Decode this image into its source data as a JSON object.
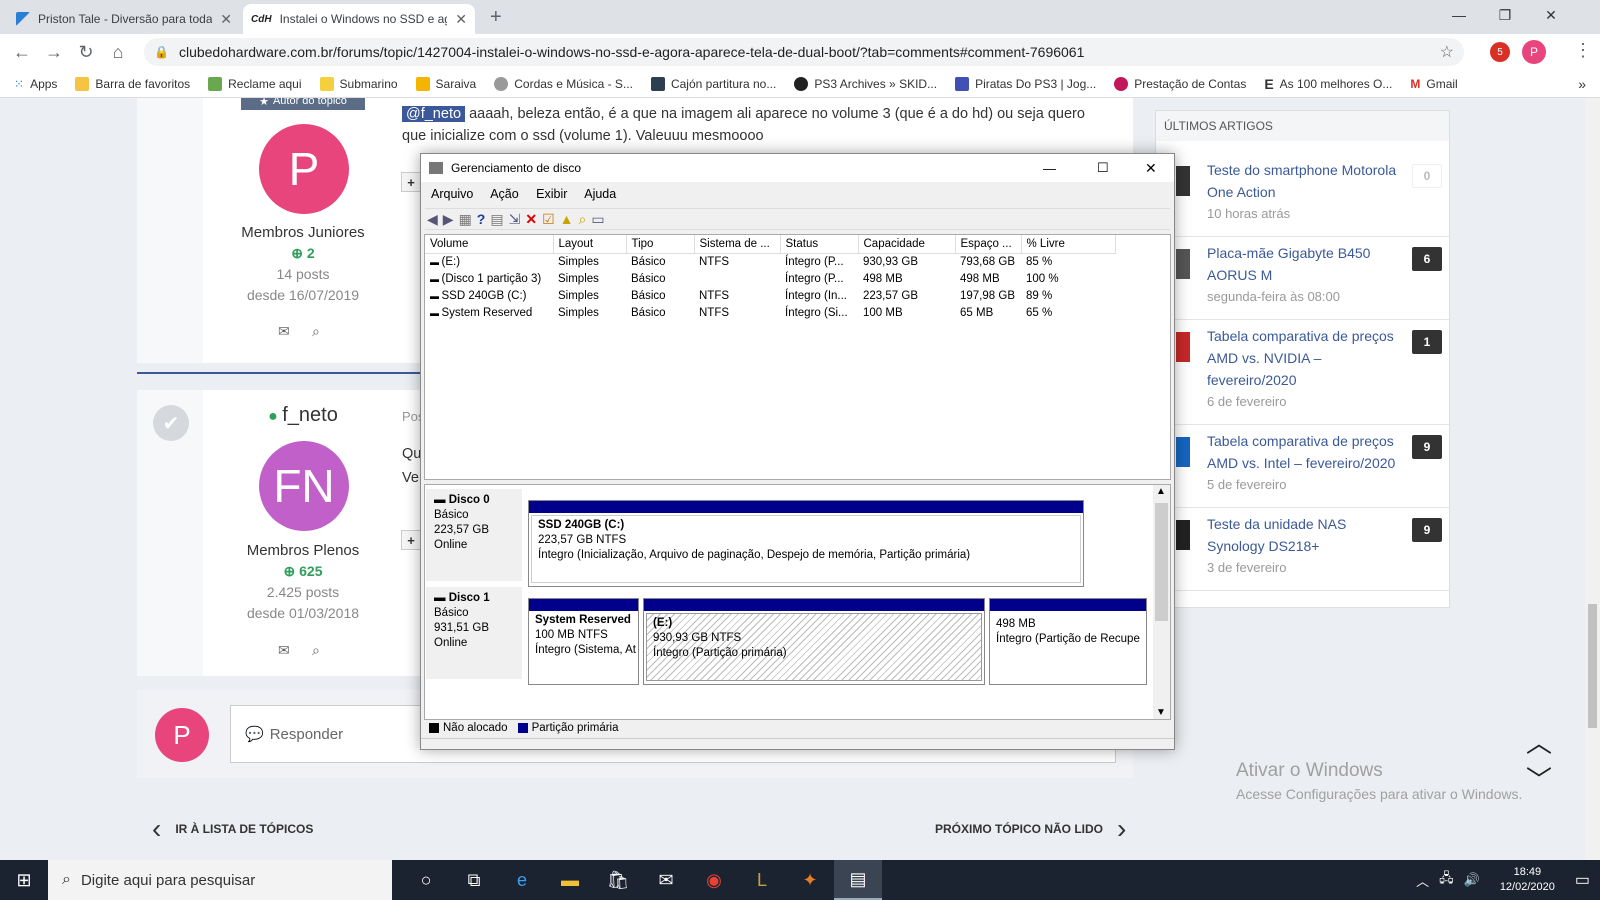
{
  "browser": {
    "tabs": [
      {
        "title": "Priston Tale - Diversão para toda",
        "icon": "priston-favicon"
      },
      {
        "title": "Instalei o Windows no SSD e agora",
        "icon": "cdh-favicon"
      }
    ],
    "url": "clubedohardware.com.br/forums/topic/1427004-instalei-o-windows-no-ssd-e-agora-aparece-tela-de-dual-boot/?tab=comments#comment-7696061",
    "profile_initial": "P",
    "extension_badge": "5",
    "bookmarks": [
      {
        "label": "Apps",
        "color": "#1a73e8"
      },
      {
        "label": "Barra de favoritos",
        "color": "#f6c343"
      },
      {
        "label": "Reclame aqui",
        "color": "#6aa84f"
      },
      {
        "label": "Submarino",
        "color": "#1e88e5"
      },
      {
        "label": "Saraiva",
        "color": "#f4b400"
      },
      {
        "label": "Cordas e Música - S...",
        "color": "#999999"
      },
      {
        "label": "Cajón partitura no...",
        "color": "#2c3e50"
      },
      {
        "label": "PS3 Archives » SKID...",
        "color": "#222222"
      },
      {
        "label": "Piratas Do PS3 | Jog...",
        "color": "#3f51b5"
      },
      {
        "label": "Prestação de Contas",
        "color": "#c2185b"
      },
      {
        "label": "As 100 melhores O...",
        "color": "#111111"
      },
      {
        "label": "Gmail",
        "color": "#d93025"
      }
    ]
  },
  "post1": {
    "badge": "Autor do tópico",
    "avatar_letter": "P",
    "group": "Membros Juniores",
    "rep": "2",
    "posts": "14 posts",
    "since": "desde 16/07/2019",
    "mention": "@f_neto",
    "text_line1": " aaaah, beleza então, é a que na imagem ali aparece no volume 3 (que é a do hd) ou seja quero",
    "text_line2": "que inicialize com o ssd (volume 1). Valeuuu mesmoooo",
    "side_btn": "+"
  },
  "post2": {
    "username": "f_neto",
    "avatar_letters": "FN",
    "group": "Membros Plenos",
    "rep": "625",
    "posts": "2.425 posts",
    "since": "desde 01/03/2018",
    "posted_prefix": "Pos",
    "text_a": "Qu",
    "text_b": "Ve",
    "side_btn": "+"
  },
  "reply": {
    "avatar_letter": "P",
    "placeholder": "Responder"
  },
  "nav_links": {
    "back": "IR À LISTA DE TÓPICOS",
    "next": "PRÓXIMO TÓPICO NÃO LIDO"
  },
  "sidebar": {
    "title": "ÚLTIMOS ARTIGOS",
    "articles": [
      {
        "title1": "Teste do smartphone Motorola",
        "title2": "One Action",
        "title3": "",
        "date": "10 horas atrás",
        "count": "0"
      },
      {
        "title1": "Placa-mãe Gigabyte B450",
        "title2": "AORUS M",
        "title3": "",
        "date": "segunda-feira às 08:00",
        "count": "6"
      },
      {
        "title1": "Tabela comparativa de preços",
        "title2": "AMD vs. NVIDIA –",
        "title3": "fevereiro/2020",
        "date": "6 de fevereiro",
        "count": "1"
      },
      {
        "title1": "Tabela comparativa de preços",
        "title2": "AMD vs. Intel – fevereiro/2020",
        "title3": "",
        "date": "5 de fevereiro",
        "count": "9"
      },
      {
        "title1": "Teste da unidade NAS",
        "title2": "Synology DS218+",
        "title3": "",
        "date": "3 de fevereiro",
        "count": "9"
      }
    ]
  },
  "activate": {
    "title": "Ativar o Windows",
    "subtitle": "Acesse Configurações para ativar o Windows."
  },
  "diskmgmt": {
    "title": "Gerenciamento de disco",
    "menu": [
      "Arquivo",
      "Ação",
      "Exibir",
      "Ajuda"
    ],
    "columns": [
      "Volume",
      "Layout",
      "Tipo",
      "Sistema de ...",
      "Status",
      "Capacidade",
      "Espaço ...",
      "% Livre"
    ],
    "rows": [
      [
        "(E:)",
        "Simples",
        "Básico",
        "NTFS",
        "Íntegro (P...",
        "930,93 GB",
        "793,68 GB",
        "85 %"
      ],
      [
        "(Disco 1 partição 3)",
        "Simples",
        "Básico",
        "",
        "Íntegro (P...",
        "498 MB",
        "498 MB",
        "100 %"
      ],
      [
        "SSD 240GB (C:)",
        "Simples",
        "Básico",
        "NTFS",
        "Íntegro (In...",
        "223,57 GB",
        "197,98 GB",
        "89 %"
      ],
      [
        "System Reserved",
        "Simples",
        "Básico",
        "NTFS",
        "Íntegro (Si...",
        "100 MB",
        "65 MB",
        "65 %"
      ]
    ],
    "disk0": {
      "name": "Disco 0",
      "type": "Básico",
      "size": "223,57 GB",
      "state": "Online",
      "part": {
        "name": "SSD 240GB  (C:)",
        "size": "223,57 GB NTFS",
        "status": "Íntegro (Inicialização, Arquivo de paginação, Despejo de memória, Partição primária)"
      }
    },
    "disk1": {
      "name": "Disco 1",
      "type": "Básico",
      "size": "931,51 GB",
      "state": "Online",
      "parts": [
        {
          "name": "System Reserved",
          "size": "100 MB NTFS",
          "status": "Íntegro (Sistema, At"
        },
        {
          "name": "(E:)",
          "size": "930,93 GB NTFS",
          "status": "Íntegro (Partição primária)"
        },
        {
          "name": "",
          "size": "498 MB",
          "status": "Íntegro (Partição de Recupe"
        }
      ]
    },
    "legend": [
      {
        "label": "Não alocado",
        "color": "#000000"
      },
      {
        "label": "Partição primária",
        "color": "#00008b"
      }
    ]
  },
  "taskbar": {
    "search_placeholder": "Digite aqui para pesquisar",
    "time": "18:49",
    "date": "12/02/2020"
  },
  "colors": {
    "accent": "#3b5998",
    "avatar_pink": "#e8457c",
    "avatar_purple": "#c060c8",
    "online": "#2e9e5b"
  }
}
